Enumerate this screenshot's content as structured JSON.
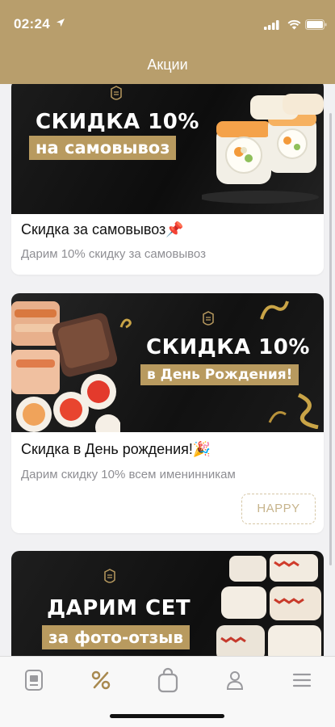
{
  "status_bar": {
    "time": "02:24"
  },
  "header": {
    "title": "Акции"
  },
  "promos": [
    {
      "banner_headline": "СКИДКА 10%",
      "banner_tag": "на самовывоз",
      "title": "Скидка за самовывоз",
      "emoji": "📌",
      "subtitle": "Дарим 10% скидку за самовывоз"
    },
    {
      "banner_headline": "СКИДКА 10%",
      "banner_tag": "в День Рождения!",
      "title": "Скидка в День рождения!",
      "emoji": "🎉",
      "subtitle": "Дарим скидку 10% всем именинникам",
      "code": "HAPPY"
    },
    {
      "banner_headline": "ДАРИМ СЕТ",
      "banner_tag": "за фото-отзыв"
    }
  ],
  "tabbar": {
    "items": [
      {
        "icon": "menu-book-icon",
        "active": false
      },
      {
        "icon": "percent-icon",
        "active": true
      },
      {
        "icon": "cart-bag-icon",
        "active": false
      },
      {
        "icon": "profile-icon",
        "active": false
      },
      {
        "icon": "hamburger-menu-icon",
        "active": false
      }
    ]
  },
  "colors": {
    "accent": "#b89e6c",
    "active_tab": "#a8894f",
    "inactive_tab": "#9a9a9e"
  }
}
